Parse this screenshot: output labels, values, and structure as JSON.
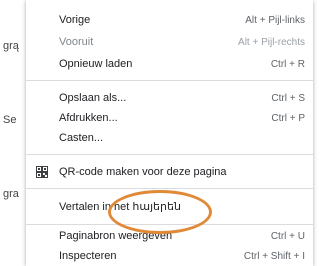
{
  "background_fragments": [
    "grą",
    "Se",
    "gra"
  ],
  "menu": {
    "items": [
      {
        "label": "Vorige",
        "shortcut": "Alt + Pijl-links",
        "disabled": false
      },
      {
        "label": "Vooruit",
        "shortcut": "Alt + Pijl-rechts",
        "disabled": true
      },
      {
        "label": "Opnieuw laden",
        "shortcut": "Ctrl + R",
        "disabled": false
      },
      {
        "label": "Opslaan als...",
        "shortcut": "Ctrl + S",
        "disabled": false
      },
      {
        "label": "Afdrukken...",
        "shortcut": "Ctrl + P",
        "disabled": false
      },
      {
        "label": "Casten...",
        "shortcut": "",
        "disabled": false
      },
      {
        "label": "QR-code maken voor deze pagina",
        "shortcut": "",
        "icon": "qr-code-icon"
      },
      {
        "label": "Vertalen in het հայերեն",
        "shortcut": ""
      },
      {
        "label": "Paginabron weergeven",
        "shortcut": "Ctrl + U"
      },
      {
        "label": "Inspecteren",
        "shortcut": "Ctrl + Shift + I"
      }
    ]
  },
  "annotation_color": "#e08a38"
}
